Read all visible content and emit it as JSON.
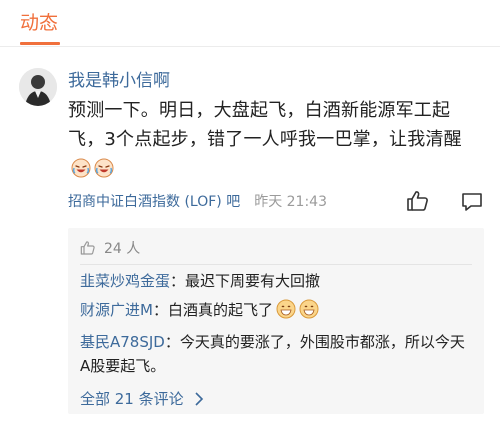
{
  "tabs": {
    "active": "动态"
  },
  "post": {
    "username": "我是韩小信啊",
    "text": "预测一下。明日，大盘起飞，白酒新能源军工起飞，3个点起步，错了一人呼我一巴掌，让我清醒",
    "source": "招商中证白酒指数 (LOF) 吧",
    "time": "昨天 21:43"
  },
  "comments_panel": {
    "likes": "24 人",
    "comments": [
      {
        "name": "韭菜炒鸡金蛋",
        "sep": "：",
        "text": "最迟下周要有大回撤"
      },
      {
        "name": "财源广进M",
        "sep": "：",
        "text": "白酒真的起飞了"
      },
      {
        "name": "基民A78SJD",
        "sep": "：",
        "text": "今天真的要涨了，外围股市都涨，所以今天A股要起飞。"
      }
    ],
    "all_label": "全部 21 条评论"
  },
  "colors": {
    "accent": "#f0703c",
    "link": "#3d6a9b",
    "panel_bg": "#f6f6f6"
  },
  "icons": [
    "user-avatar",
    "laughing-crying-emoji",
    "thumbs-up-icon",
    "comment-icon",
    "grinning-emoji",
    "chevron-right-icon"
  ]
}
